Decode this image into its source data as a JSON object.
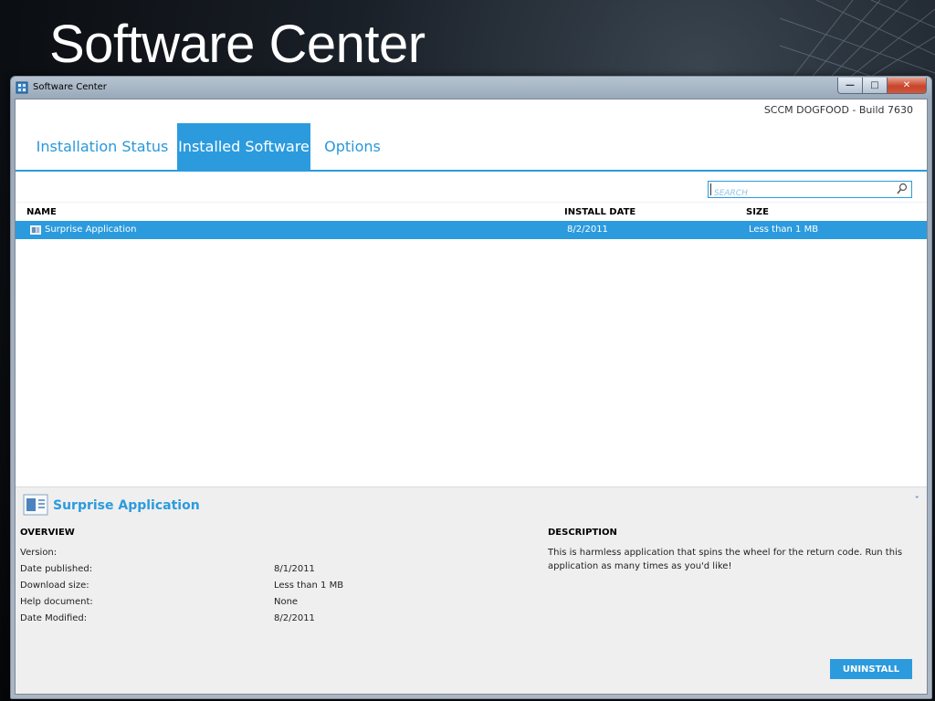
{
  "slide": {
    "title": "Software Center"
  },
  "window": {
    "title": "Software Center",
    "build_label": "SCCM DOGFOOD - Build 7630",
    "controls": {
      "minimize": "—",
      "maximize": "□",
      "close": "✕"
    }
  },
  "tabs": [
    {
      "label": "Installation Status",
      "active": false
    },
    {
      "label": "Installed Software",
      "active": true
    },
    {
      "label": "Options",
      "active": false
    }
  ],
  "search": {
    "placeholder": "SEARCH",
    "icon": "search-icon"
  },
  "list": {
    "columns": [
      "NAME",
      "INSTALL DATE",
      "SIZE"
    ],
    "rows": [
      {
        "name": "Surprise Application",
        "install_date": "8/2/2011",
        "size": "Less than 1 MB",
        "selected": true
      }
    ]
  },
  "details": {
    "title": "Surprise Application",
    "overview_heading": "OVERVIEW",
    "fields": [
      {
        "label": "Version:",
        "value": ""
      },
      {
        "label": "Date published:",
        "value": "8/1/2011"
      },
      {
        "label": "Download size:",
        "value": "Less than 1 MB"
      },
      {
        "label": "Help document:",
        "value": "None"
      },
      {
        "label": "Date Modified:",
        "value": "8/2/2011"
      }
    ],
    "description_heading": "DESCRIPTION",
    "description": "This is harmless application that spins the wheel for the return code. Run this application as many times as you'd like!",
    "collapse_glyph": "ˇ",
    "uninstall_label": "UNINSTALL"
  },
  "colors": {
    "accent": "#2b9bde",
    "panel": "#efefef"
  }
}
